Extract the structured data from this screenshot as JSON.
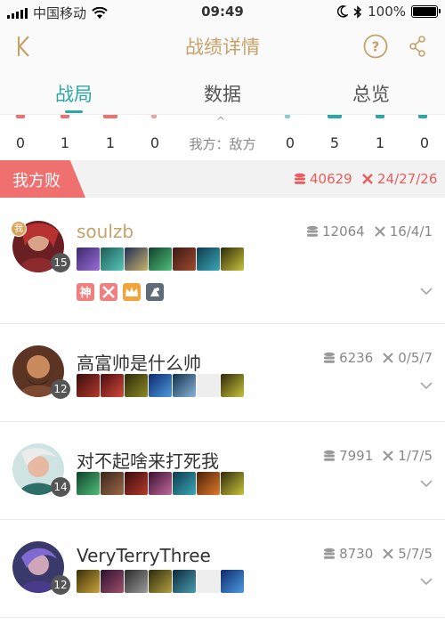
{
  "status": {
    "carrier": "中国移动",
    "time": "09:49",
    "battery": "100%"
  },
  "header": {
    "title": "战绩详情"
  },
  "tabs": [
    {
      "label": "战局",
      "active": true
    },
    {
      "label": "数据",
      "active": false
    },
    {
      "label": "总览",
      "active": false
    }
  ],
  "summary": {
    "left": [
      "0",
      "1",
      "1",
      "0"
    ],
    "label": "我方：敌方",
    "right": [
      "0",
      "5",
      "1",
      "0"
    ]
  },
  "result": {
    "label": "我方败",
    "gold": "40629",
    "kda": "24/27/26"
  },
  "players": [
    {
      "name": "soulzb",
      "level": "15",
      "mvp": "我",
      "gold": "12064",
      "kda": "16/4/1",
      "highlight": true,
      "badges": 4
    },
    {
      "name": "高富帅是什么帅",
      "level": "12",
      "gold": "6236",
      "kda": "0/5/7"
    },
    {
      "name": "对不起啥来打死我",
      "level": "14",
      "gold": "7991",
      "kda": "1/7/5"
    },
    {
      "name": "VeryTerryThree",
      "level": "12",
      "gold": "8730",
      "kda": "5/7/5"
    }
  ],
  "colors": {
    "accent": "#2aa8a6",
    "gold": "#c5a26a",
    "loss": "#f07070"
  }
}
